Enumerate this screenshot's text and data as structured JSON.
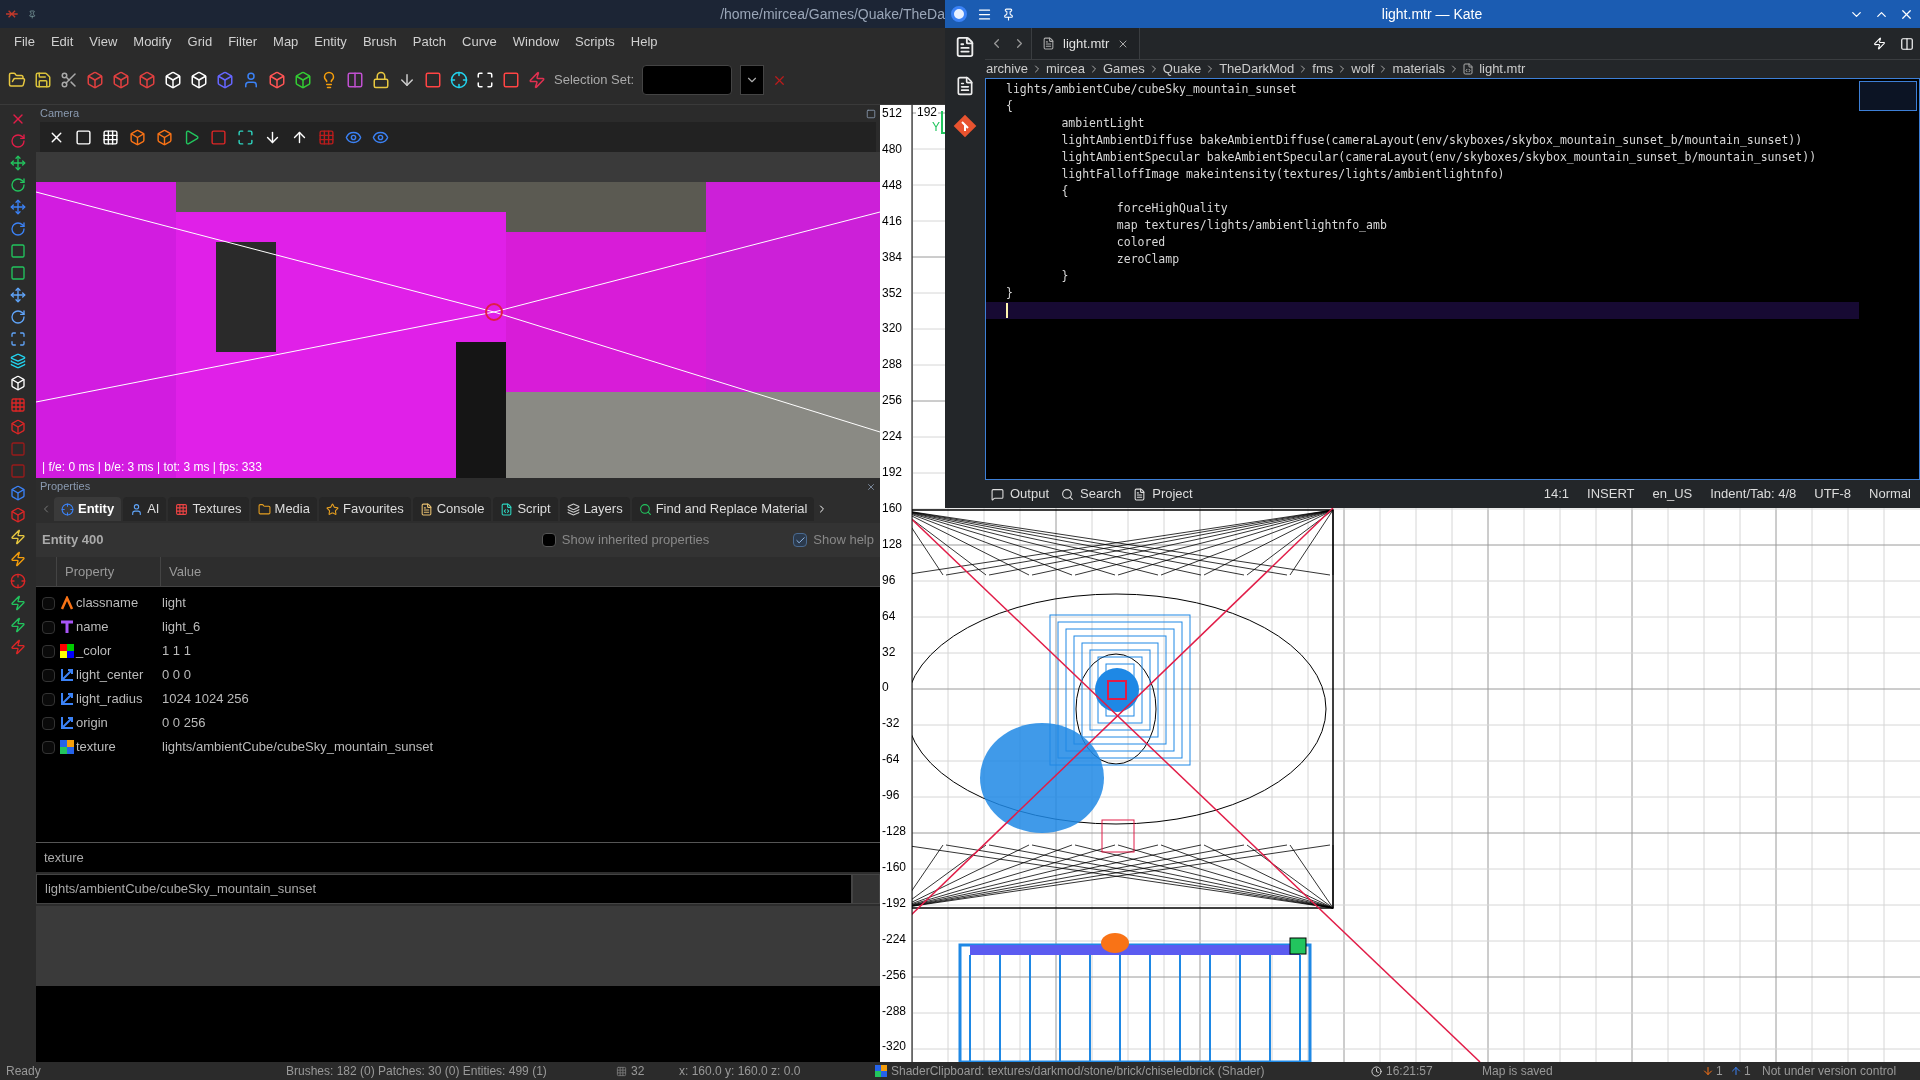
{
  "darkradiant": {
    "title": "/home/mircea/Games/Quake/TheDa",
    "menu": [
      "File",
      "Edit",
      "View",
      "Modify",
      "Grid",
      "Filter",
      "Map",
      "Entity",
      "Brush",
      "Patch",
      "Curve",
      "Window",
      "Scripts",
      "Help"
    ],
    "selection_set_label": "Selection Set:"
  },
  "camera": {
    "title": "Camera",
    "stats": "| f/e: 0 ms | b/e: 3 ms | tot: 3 ms | fps: 333"
  },
  "properties": {
    "title": "Properties",
    "tabs": [
      {
        "label": "Entity",
        "selected": true
      },
      {
        "label": "AI",
        "selected": false
      },
      {
        "label": "Textures",
        "selected": false
      },
      {
        "label": "Media",
        "selected": false
      },
      {
        "label": "Favourites",
        "selected": false
      },
      {
        "label": "Console",
        "selected": false
      },
      {
        "label": "Script",
        "selected": false
      },
      {
        "label": "Layers",
        "selected": false
      },
      {
        "label": "Find and Replace Material",
        "selected": false
      }
    ],
    "entity": "Entity 400",
    "show_inherited": {
      "label": "Show inherited properties",
      "checked": false
    },
    "show_help": {
      "label": "Show help",
      "checked": true
    },
    "columns": [
      "Property",
      "Value"
    ],
    "rows": [
      {
        "kind": "class",
        "key": "classname",
        "value": "light",
        "checked": false
      },
      {
        "kind": "text",
        "key": "name",
        "value": "light_6",
        "checked": false
      },
      {
        "kind": "color",
        "key": "_color",
        "value": "1 1 1",
        "checked": false
      },
      {
        "kind": "vector",
        "key": "light_center",
        "value": "0 0 0",
        "checked": false
      },
      {
        "kind": "vector",
        "key": "light_radius",
        "value": "1024 1024 256",
        "checked": false
      },
      {
        "kind": "vector",
        "key": "origin",
        "value": "0 0 256",
        "checked": false
      },
      {
        "kind": "texture",
        "key": "texture",
        "value": "lights/ambientCube/cubeSky_mountain_sunset",
        "checked": false
      }
    ],
    "help_key": "texture",
    "edit_value": "lights/ambientCube/cubeSky_mountain_sunset"
  },
  "view2d": {
    "top_label": "192",
    "axis_label": "Y",
    "ruler": [
      "512",
      "480",
      "448",
      "416",
      "384",
      "352",
      "320",
      "288",
      "256",
      "224",
      "192",
      "160",
      "128",
      "96",
      "64",
      "32",
      "0",
      "-32",
      "-64",
      "-96",
      "-128",
      "-160",
      "-192",
      "-224",
      "-256",
      "-288",
      "-320"
    ]
  },
  "kate": {
    "title": "light.mtr — Kate",
    "tab": "light.mtr",
    "breadcrumbs": [
      "archive",
      "mircea",
      "Games",
      "Quake",
      "TheDarkMod",
      "fms",
      "wolf",
      "materials",
      "light.mtr"
    ],
    "lines": [
      "lights/ambientCube/cubeSky_mountain_sunset",
      "{",
      "\tambientLight",
      "\tlightAmbientDiffuse bakeAmbientDiffuse(cameraLayout(env/skyboxes/skybox_mountain_sunset_b/mountain_sunset))",
      "\tlightAmbientSpecular bakeAmbientSpecular(cameraLayout(env/skyboxes/skybox_mountain_sunset_b/mountain_sunset))",
      "\tlightFalloffImage makeintensity(textures/lights/ambientlightnfo)",
      "\t{",
      "\t\tforceHighQuality",
      "\t\tmap textures/lights/ambientlightnfo_amb",
      "\t\tcolored",
      "\t\tzeroClamp",
      "\t}",
      "}"
    ],
    "tool_tabs": [
      "Output",
      "Search",
      "Project"
    ],
    "status": [
      "14:1",
      "INSERT",
      "en_US",
      "Indent/Tab: 4/8",
      "UTF-8",
      "Normal"
    ]
  },
  "status_bar": {
    "ready": "Ready",
    "counts": "Brushes: 182 (0) Patches: 30 (0) Entities: 499 (1)",
    "grid": "32",
    "position": "x:  160.0 y:  160.0 z:  0.0",
    "shader": "ShaderClipboard: textures/darkmod/stone/brick/chiseledbrick (Shader)",
    "time": "16:21:57",
    "map_state": "Map is saved",
    "outgoing": "1",
    "incoming": "1",
    "vcs": "Not under version control"
  }
}
